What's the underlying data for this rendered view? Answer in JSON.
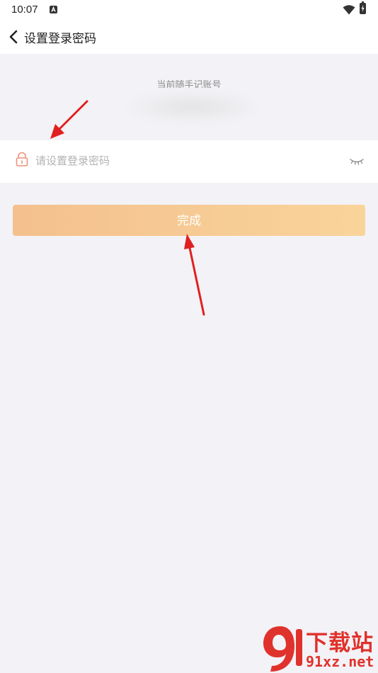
{
  "status_bar": {
    "time": "10:07",
    "notification_icon": "a-notification-icon",
    "wifi_icon": "wifi-icon",
    "battery_icon": "battery-charging-icon"
  },
  "header": {
    "back_icon": "chevron-left-icon",
    "title": "设置登录密码"
  },
  "account": {
    "label": "当前随手记账号"
  },
  "password": {
    "placeholder": "请设置登录密码",
    "value": "",
    "lock_icon": "lock-icon",
    "visibility_icon": "eye-closed-icon"
  },
  "done_button": {
    "label": "完成"
  },
  "watermark": {
    "title": "下载站",
    "domain": "91xz.net"
  },
  "colors": {
    "background": "#f3f2f6",
    "button_gradient_start": "#f4c08e",
    "button_gradient_end": "#f9d49a",
    "lock_accent": "#f0907a",
    "annotation_arrow": "#e02020",
    "watermark_red": "#e0322c"
  }
}
